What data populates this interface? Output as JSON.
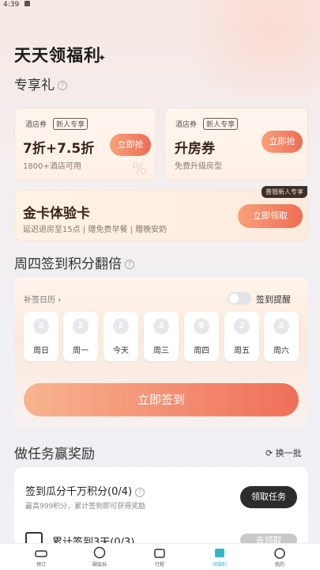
{
  "status_bar": {
    "time": "4:39"
  },
  "header": {
    "title": "天天领福利"
  },
  "exclusive": {
    "title": "专享礼",
    "coupons": [
      {
        "tag": "酒店券",
        "badge": "新人专享",
        "value": "7折+7.5折",
        "sub": "1800+酒店可用",
        "button": "立即抢"
      },
      {
        "tag": "酒店券",
        "badge": "新人专享",
        "value": "升房券",
        "sub": "免费升级房型",
        "button": "立即抢"
      }
    ],
    "gold_card": {
      "badge": "普银新人专享",
      "title": "金卡体验卡",
      "sub": "延迟退房至15点 | 赠免费早餐 | 赠晚安奶",
      "button": "立即领取"
    }
  },
  "checkin": {
    "title": "周四签到积分翻倍",
    "calendar_link": "补签日历",
    "reminder_label": "签到提醒",
    "days": [
      {
        "points": "2",
        "label": "周日"
      },
      {
        "points": "2",
        "label": "周一"
      },
      {
        "points": "2",
        "label": "今天"
      },
      {
        "points": "2",
        "label": "周三"
      },
      {
        "points": "8",
        "label": "周四"
      },
      {
        "points": "2",
        "label": "周五"
      },
      {
        "points": "2",
        "label": "周六"
      }
    ],
    "button": "立即签到"
  },
  "tasks": {
    "title": "做任务赢奖励",
    "refresh": "换一批",
    "items": [
      {
        "title": "签到瓜分千万积分(0/4)",
        "sub": "最高999积分，累计签到即可获得奖励",
        "button": "领取任务"
      },
      {
        "title": "累计签到3天(0/3)",
        "button": "去领取"
      }
    ]
  },
  "nav": {
    "items": [
      {
        "label": "预订"
      },
      {
        "label": "颐会玩"
      },
      {
        "label": "行程"
      },
      {
        "label": "领福利"
      },
      {
        "label": "我的"
      }
    ]
  },
  "colors": {
    "accent": "#ef6c55",
    "dark_button": "#2c2c2e",
    "nav_active": "#35b7c7"
  }
}
